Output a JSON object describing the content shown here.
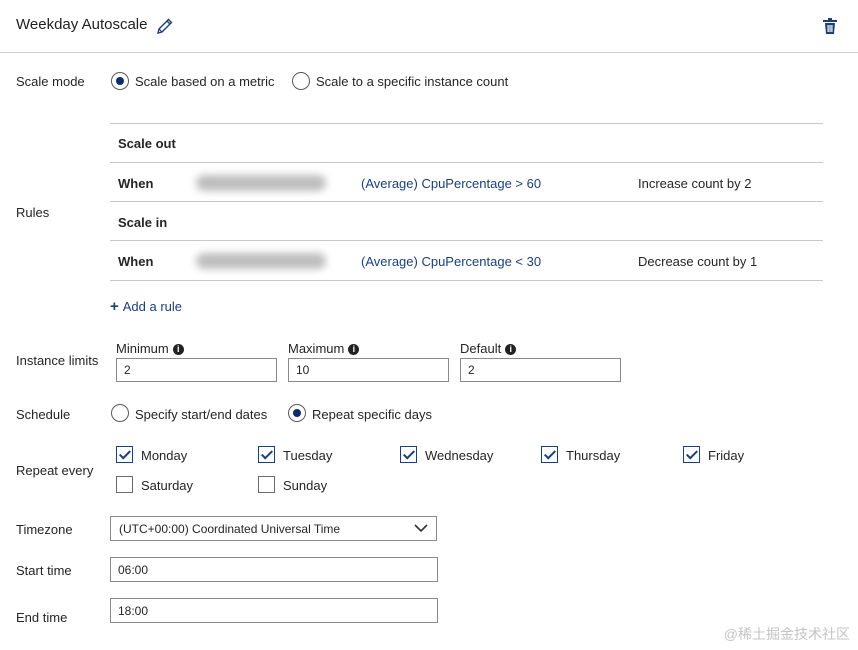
{
  "header": {
    "title": "Weekday Autoscale"
  },
  "scale_mode": {
    "label": "Scale mode",
    "options": [
      {
        "label": "Scale based on a metric",
        "selected": true
      },
      {
        "label": "Scale to a specific instance count",
        "selected": false
      }
    ]
  },
  "rules": {
    "label": "Rules",
    "scale_out_label": "Scale out",
    "scale_in_label": "Scale in",
    "scale_out": {
      "when": "When",
      "metric": "(Average) CpuPercentage > 60",
      "action": "Increase count by 2"
    },
    "scale_in": {
      "when": "When",
      "metric": "(Average) CpuPercentage < 30",
      "action": "Decrease count by 1"
    },
    "add_rule": "Add a rule"
  },
  "instance_limits": {
    "label": "Instance limits",
    "minimum": {
      "label": "Minimum",
      "value": "2"
    },
    "maximum": {
      "label": "Maximum",
      "value": "10"
    },
    "default": {
      "label": "Default",
      "value": "2"
    }
  },
  "schedule": {
    "label": "Schedule",
    "options": [
      {
        "label": "Specify start/end dates",
        "selected": false
      },
      {
        "label": "Repeat specific days",
        "selected": true
      }
    ]
  },
  "repeat_every": {
    "label": "Repeat every",
    "days": [
      {
        "label": "Monday",
        "checked": true
      },
      {
        "label": "Tuesday",
        "checked": true
      },
      {
        "label": "Wednesday",
        "checked": true
      },
      {
        "label": "Thursday",
        "checked": true
      },
      {
        "label": "Friday",
        "checked": true
      },
      {
        "label": "Saturday",
        "checked": false
      },
      {
        "label": "Sunday",
        "checked": false
      }
    ]
  },
  "timezone": {
    "label": "Timezone",
    "value": "(UTC+00:00) Coordinated Universal Time"
  },
  "start_time": {
    "label": "Start time",
    "value": "06:00"
  },
  "end_time": {
    "label": "End time",
    "value": "18:00"
  },
  "watermark": "@稀土掘金技术社区",
  "colors": {
    "accent": "#1b3f7a",
    "radio_fill": "#0b2e6b"
  },
  "icons": {
    "edit": "pencil-icon",
    "delete": "trash-icon",
    "info": "info-icon",
    "dropdown": "chevron-down-icon",
    "add": "plus-icon"
  }
}
